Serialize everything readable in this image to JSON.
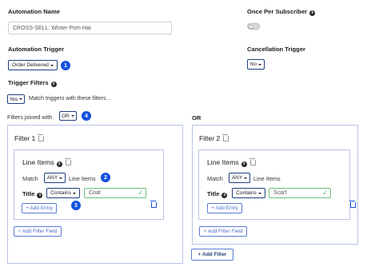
{
  "automation_name": {
    "label": "Automation Name",
    "value": "CROSS-SELL: Winter Pom Hat"
  },
  "once_per_subscriber": {
    "label": "Once Per Subscriber"
  },
  "automation_trigger": {
    "label": "Automation Trigger",
    "value": "Order Delivered",
    "badge": "1"
  },
  "cancellation_trigger": {
    "label": "Cancellation Trigger",
    "value": "No"
  },
  "trigger_filters": {
    "label": "Trigger Filters",
    "yes_value": "Yes",
    "match_text": "Match triggers with these filters..."
  },
  "filters_joined": {
    "label": "Filters joined with",
    "value": "OR",
    "badge": "4"
  },
  "or_label": "OR",
  "filter1": {
    "title": "Filter 1",
    "line_items_title": "Line Items",
    "match_label": "Match",
    "match_value": "ANY",
    "match_suffix": "Line Items",
    "match_badge": "2",
    "field_label": "Title",
    "operator": "Contains",
    "value": "Coat",
    "add_entry": "+ Add Entry",
    "entry_badge": "3",
    "add_filter_field": "+ Add Filter Field"
  },
  "filter2": {
    "title": "Filter 2",
    "line_items_title": "Line Items",
    "match_label": "Match",
    "match_value": "ANY",
    "match_suffix": "Line Items",
    "field_label": "Title",
    "operator": "Contains",
    "value": "Scarf",
    "add_entry": "+ Add Entry",
    "add_filter_field": "+ Add Filter Field"
  },
  "add_filter_button": "+ Add Filter",
  "colors": {
    "accent": "#1552e0",
    "border": "#b8c4e8",
    "valid": "#3aa653"
  }
}
